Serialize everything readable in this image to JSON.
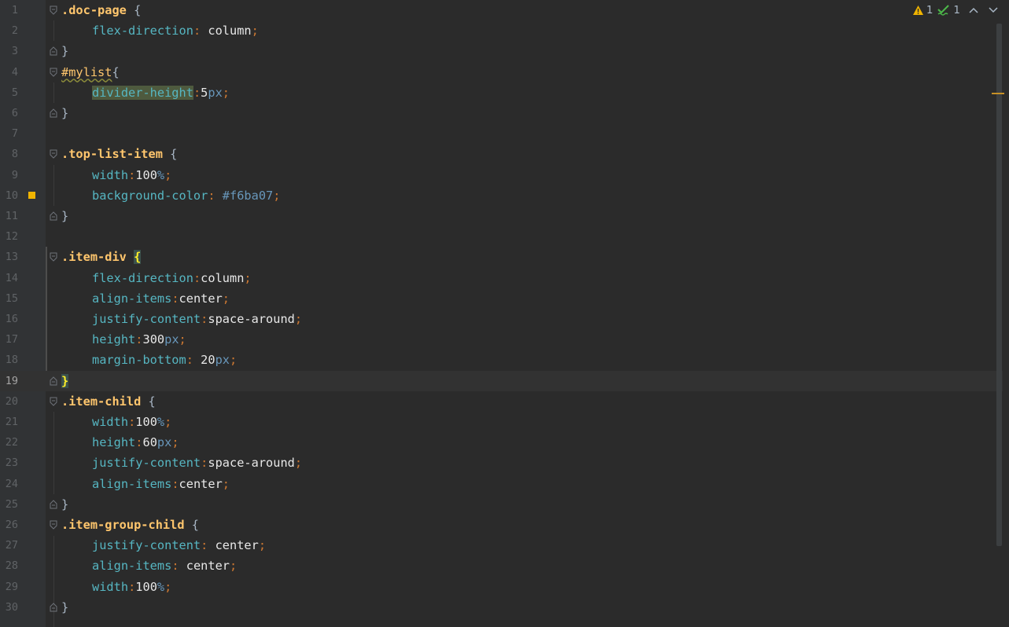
{
  "status": {
    "warnings": "1",
    "checks": "1"
  },
  "lines": [
    {
      "n": "1"
    },
    {
      "n": "2"
    },
    {
      "n": "3"
    },
    {
      "n": "4"
    },
    {
      "n": "5"
    },
    {
      "n": "6"
    },
    {
      "n": "7"
    },
    {
      "n": "8"
    },
    {
      "n": "9"
    },
    {
      "n": "10"
    },
    {
      "n": "11"
    },
    {
      "n": "12"
    },
    {
      "n": "13"
    },
    {
      "n": "14"
    },
    {
      "n": "15"
    },
    {
      "n": "16"
    },
    {
      "n": "17"
    },
    {
      "n": "18"
    },
    {
      "n": "19"
    },
    {
      "n": "20"
    },
    {
      "n": "21"
    },
    {
      "n": "22"
    },
    {
      "n": "23"
    },
    {
      "n": "24"
    },
    {
      "n": "25"
    },
    {
      "n": "26"
    },
    {
      "n": "27"
    },
    {
      "n": "28"
    },
    {
      "n": "29"
    },
    {
      "n": "30"
    }
  ],
  "code": {
    "l1": {
      "sel": ".doc-page",
      "open": " {"
    },
    "l2": {
      "prop": "flex-direction",
      "colon": ": ",
      "val": "column",
      "semi": ";"
    },
    "l3": {
      "close": "}"
    },
    "l4": {
      "sel": "#mylist",
      "open": "{"
    },
    "l5": {
      "prop": "divider-height",
      "colon": ":",
      "num": "5",
      "unit": "px",
      "semi": ";"
    },
    "l6": {
      "close": "}"
    },
    "l8": {
      "sel": ".top-list-item",
      "open": " {"
    },
    "l9": {
      "prop": "width",
      "colon": ":",
      "num": "100",
      "unit": "%",
      "semi": ";"
    },
    "l10": {
      "prop": "background-color",
      "colon": ": ",
      "val": "#f6ba07",
      "semi": ";"
    },
    "l11": {
      "close": "}"
    },
    "l13": {
      "sel": ".item-div",
      "open": "{"
    },
    "l14": {
      "prop": "flex-direction",
      "colon": ":",
      "val": "column",
      "semi": ";"
    },
    "l15": {
      "prop": "align-items",
      "colon": ":",
      "val": "center",
      "semi": ";"
    },
    "l16": {
      "prop": "justify-content",
      "colon": ":",
      "val": "space-around",
      "semi": ";"
    },
    "l17": {
      "prop": "height",
      "colon": ":",
      "num": "300",
      "unit": "px",
      "semi": ";"
    },
    "l18": {
      "prop": "margin-bottom",
      "colon": ": ",
      "num": "20",
      "unit": "px",
      "semi": ";"
    },
    "l19": {
      "close": "}"
    },
    "l20": {
      "sel": ".item-child",
      "open": " {"
    },
    "l21": {
      "prop": "width",
      "colon": ":",
      "num": "100",
      "unit": "%",
      "semi": ";"
    },
    "l22": {
      "prop": "height",
      "colon": ":",
      "num": "60",
      "unit": "px",
      "semi": ";"
    },
    "l23": {
      "prop": "justify-content",
      "colon": ":",
      "val": "space-around",
      "semi": ";"
    },
    "l24": {
      "prop": "align-items",
      "colon": ":",
      "val": "center",
      "semi": ";"
    },
    "l25": {
      "close": "}"
    },
    "l26": {
      "sel": ".item-group-child",
      "open": " {"
    },
    "l27": {
      "prop": "justify-content",
      "colon": ": ",
      "val": "center",
      "semi": ";"
    },
    "l28": {
      "prop": "align-items",
      "colon": ": ",
      "val": "center",
      "semi": ";"
    },
    "l29": {
      "prop": "width",
      "colon": ":",
      "num": "100",
      "unit": "%",
      "semi": ";"
    },
    "l30": {
      "close": "}"
    }
  },
  "colors": {
    "background": "#2b2b2b",
    "gutter": "#313335",
    "selector": "#ffc66d",
    "property": "#56b6c2",
    "unit": "#6897bb",
    "warning": "#f0b400"
  }
}
